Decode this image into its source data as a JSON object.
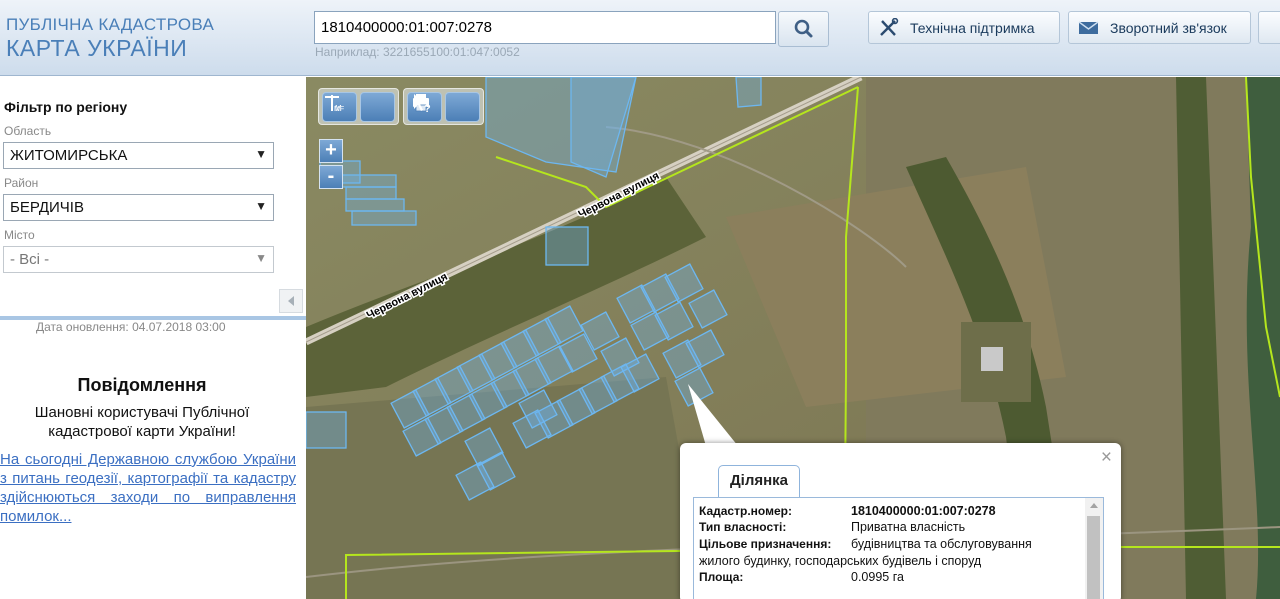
{
  "header": {
    "logo_line1": "ПУБЛІЧНА КАДАСТРОВА",
    "logo_line2": "КАРТА УКРАЇНИ",
    "search_value": "1810400000:01:007:0278",
    "search_hint": "Наприклад: 3221655100:01:047:0052",
    "support_label": "Технічна підтримка",
    "feedback_label": "Зворотний зв'язок"
  },
  "sidebar": {
    "filter_title": "Фільтр по регіону",
    "oblast_label": "Область",
    "oblast_value": "ЖИТОМИРСЬКА",
    "raion_label": "Район",
    "raion_value": "БЕРДИЧІВ",
    "city_label": "Місто",
    "city_value": "- Всі -",
    "update_date": "Дата оновлення: 04.07.2018 03:00",
    "notice_title": "Повідомлення",
    "notice_text": "Шановні користувачі Публічної кадастрової карти України!",
    "notice_link": "На сьогодні Державною службою України з питань геодезії, картографії та кадастру здійснюються заходи по виправлення помилок..."
  },
  "map": {
    "street_label_1": "Червона вулиця",
    "street_label_2": "Червона вулиця",
    "toolbar_m": "М",
    "toolbar_mf": "МF",
    "zoom_in": "+",
    "zoom_out": "-"
  },
  "popup": {
    "tab_label": "Ділянка",
    "close": "×",
    "rows": [
      {
        "label": "Кадастр.номер:",
        "value": "1810400000:01:007:0278"
      },
      {
        "label": "Тип власності:",
        "value": "Приватна власність"
      },
      {
        "label": "Цільове призначення:",
        "value": "будівництва та обслуговування"
      },
      {
        "label": "",
        "value": "жилого будинку, господарських будівель і споруд"
      },
      {
        "label": "Площа:",
        "value": "0.0995 га"
      }
    ]
  },
  "colors": {
    "header_blue": "#4a7fb8",
    "parcel_blue": "#69b4ee",
    "boundary_green": "#b5e61d",
    "link_blue": "#3b6fc2"
  },
  "icons": [
    "search-icon",
    "support-tools-icon",
    "envelope-icon",
    "print-icon",
    "help-pointer-icon",
    "ruler-icon",
    "area-ruler-icon",
    "collapse-arrow-icon"
  ]
}
